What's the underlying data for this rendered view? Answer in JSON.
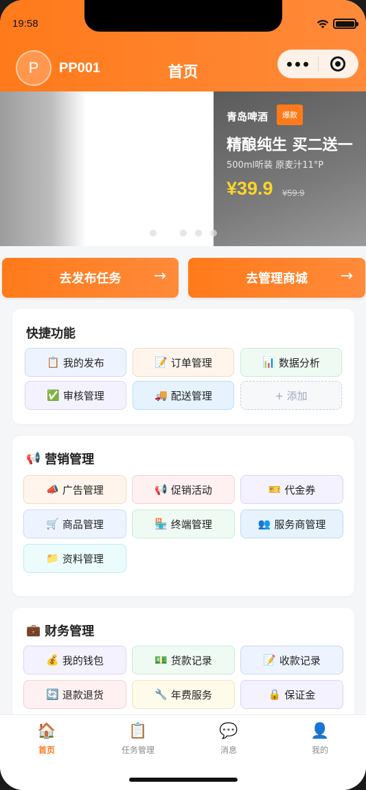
{
  "status": {
    "time": "19:58"
  },
  "header": {
    "avatar_letter": "P",
    "username": "PP001",
    "title": "首页"
  },
  "banner": {
    "brand": "青岛啤酒",
    "badge": "爆款",
    "title": "精酿纯生 买二送一",
    "subtitle": "500ml听装 原麦汁11°P",
    "price": "¥39.9",
    "old_price": "¥59.9",
    "active_dot": 1,
    "dot_count": 5
  },
  "actions": {
    "publish_label": "去发布任务",
    "mall_label": "去管理商城",
    "arrow": "→"
  },
  "quick": {
    "title": "快捷功能",
    "items": [
      {
        "icon": "📋",
        "label": "我的发布"
      },
      {
        "icon": "📝",
        "label": "订单管理"
      },
      {
        "icon": "📊",
        "label": "数据分析"
      },
      {
        "icon": "✅",
        "label": "审核管理"
      },
      {
        "icon": "🚚",
        "label": "配送管理"
      },
      {
        "icon": "",
        "label": "+ 添加"
      }
    ]
  },
  "marketing": {
    "icon": "📢",
    "title": "营销管理",
    "items": [
      {
        "icon": "📣",
        "label": "广告管理"
      },
      {
        "icon": "📢",
        "label": "促销活动"
      },
      {
        "icon": "🎫",
        "label": "代金券"
      },
      {
        "icon": "🛒",
        "label": "商品管理"
      },
      {
        "icon": "🏪",
        "label": "终端管理"
      },
      {
        "icon": "👥",
        "label": "服务商管理"
      },
      {
        "icon": "📁",
        "label": "资料管理"
      }
    ]
  },
  "finance": {
    "icon": "💼",
    "title": "财务管理",
    "items": [
      {
        "icon": "💰",
        "label": "我的钱包"
      },
      {
        "icon": "💵",
        "label": "货款记录"
      },
      {
        "icon": "📝",
        "label": "收款记录"
      },
      {
        "icon": "🔄",
        "label": "退款退货"
      },
      {
        "icon": "🔧",
        "label": "年费服务"
      },
      {
        "icon": "🔒",
        "label": "保证金"
      }
    ]
  },
  "tabbar": [
    {
      "icon": "🏠",
      "label": "首页"
    },
    {
      "icon": "📋",
      "label": "任务管理"
    },
    {
      "icon": "💬",
      "label": "消息"
    },
    {
      "icon": "👤",
      "label": "我的"
    }
  ],
  "colors": {
    "brand": "#ff7a1a",
    "price": "#ffd42a"
  }
}
